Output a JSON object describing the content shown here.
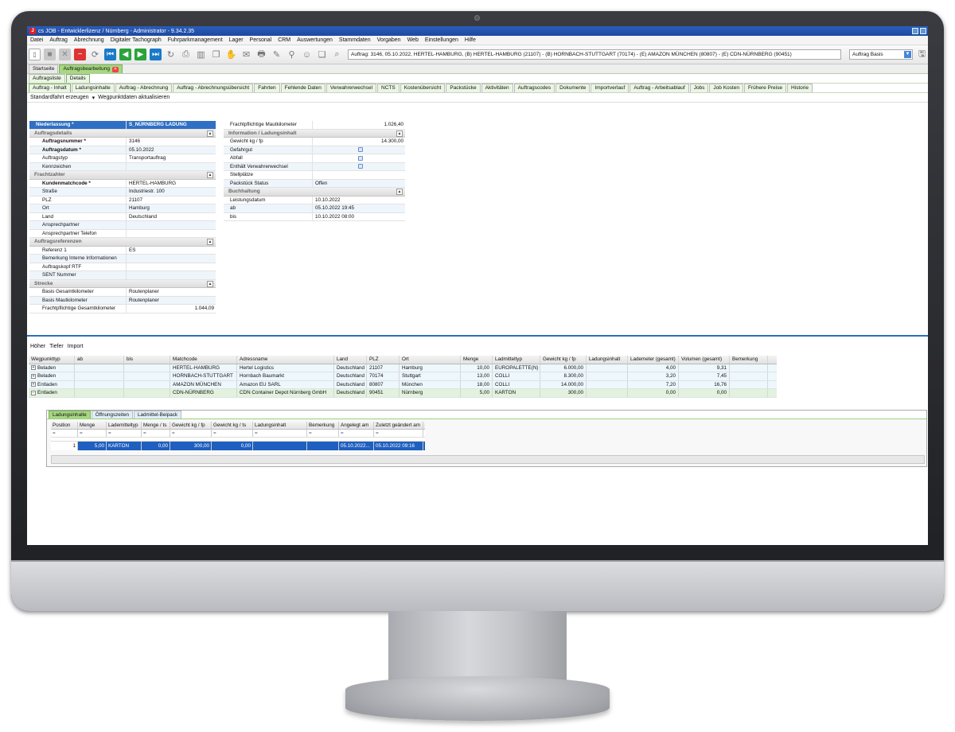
{
  "app": {
    "title": "cs JOB - Entwicklerlizenz / Nürnberg - Administrator - 9.34.2.35"
  },
  "menu": [
    "Datei",
    "Auftrag",
    "Abrechnung",
    "Digitaler Tachograph",
    "Fuhrparkmanagement",
    "Lager",
    "Personal",
    "CRM",
    "Auswertungen",
    "Stammdaten",
    "Vorgaben",
    "Web",
    "Einstellungen",
    "Hilfe"
  ],
  "toolbar": {
    "order_summary": "Auftrag: 3146, 05.10.2022, HERTEL-HAMBURG, (B) HERTEL-HAMBURG (21107) - (B) HORNBACH-STUTTGART (70174) - (E) AMAZON MÜNCHEN (80807) - (E) CDN-NÜRNBERG (90451)",
    "view_select": "Auftrag Basis"
  },
  "main_tabs": [
    {
      "label": "Startseite",
      "active": false
    },
    {
      "label": "Auftragsbearbeitung",
      "active": true
    }
  ],
  "view_tabs": [
    {
      "label": "Auftragsliste",
      "active": false
    },
    {
      "label": "Details",
      "active": true
    }
  ],
  "detail_tabs": [
    "Auftrag - Inhalt",
    "Ladungsinhalte",
    "Auftrag - Abrechnung",
    "Auftrag - Abrechnungsübersicht",
    "Fahrten",
    "Fehlende Daten",
    "Verwahrerwechsel",
    "NCTS",
    "Kostenübersicht",
    "Packstücke",
    "Aktivitäten",
    "Auftragscodes",
    "Dokumente",
    "Importverlauf",
    "Auftrag - Arbeitsablauf",
    "Jobs",
    "Job Kosten",
    "Frühere Preise",
    "Historie"
  ],
  "actions": [
    "Standardfahrt erzeugen",
    "Wegpunktdaten aktualisieren"
  ],
  "left_panel": {
    "niederlassung": {
      "label": "Niederlassung *",
      "value": "S_NÜRNBERG LADUNG"
    },
    "sections": [
      {
        "title": "Auftragsdetails",
        "rows": [
          {
            "label": "Auftragsnummer *",
            "value": "3146",
            "bold": true
          },
          {
            "label": "Auftragsdatum *",
            "value": "05.10.2022",
            "bold": true
          },
          {
            "label": "Auftragstyp",
            "value": "Transportauftrag"
          },
          {
            "label": "Kennzeichen",
            "value": ""
          }
        ]
      },
      {
        "title": "Frachtzahler",
        "rows": [
          {
            "label": "Kundenmatchcode *",
            "value": "HERTEL-HAMBURG",
            "bold": true
          },
          {
            "label": "Straße",
            "value": "Industriestr. 100"
          },
          {
            "label": "PLZ",
            "value": "21107"
          },
          {
            "label": "Ort",
            "value": "Hamburg"
          },
          {
            "label": "Land",
            "value": "Deutschland"
          },
          {
            "label": "Ansprechpartner",
            "value": ""
          },
          {
            "label": "Ansprechpartner Telefon",
            "value": ""
          }
        ]
      },
      {
        "title": "Auftragsreferenzen",
        "rows": [
          {
            "label": "Referenz 1",
            "value": "ES"
          },
          {
            "label": "Bemerkung Interne Informationen",
            "value": ""
          },
          {
            "label": "Auftragskopf RTF",
            "value": ""
          },
          {
            "label": "SENT Nummer",
            "value": ""
          }
        ]
      },
      {
        "title": "Strecke",
        "rows": [
          {
            "label": "Basis Gesamtkilometer",
            "value": "Routenplaner"
          },
          {
            "label": "Basis Mautkilometer",
            "value": "Routenplaner"
          },
          {
            "label": "Frachtpflichtige Gesamtkilometer",
            "value": "1.044,09",
            "num": true
          }
        ]
      }
    ]
  },
  "mid_panel": {
    "top_row": {
      "label": "Frachtpflichtige Mautkilometer",
      "value": "1.026,40"
    },
    "info_title": "Information / Ladungsinhalt",
    "info_rows": [
      {
        "label": "Gewicht kg / fp",
        "value": "14.300,00",
        "num": true
      },
      {
        "label": "Gefahrgut",
        "value": "",
        "check": true
      },
      {
        "label": "Abfall",
        "value": "",
        "check": true
      },
      {
        "label": "Enthält Verwahrerwechsel",
        "value": "",
        "check": true
      },
      {
        "label": "Stellplätze",
        "value": ""
      },
      {
        "label": "Packstück Status",
        "value": "Offen"
      }
    ],
    "buch_title": "Buchhaltung",
    "buch_rows": [
      {
        "label": "Leistungsdatum",
        "value": "10.10.2022"
      },
      {
        "label": "ab",
        "value": "05.10.2022 19:45"
      },
      {
        "label": "bis",
        "value": "10.10.2022 08:00"
      }
    ]
  },
  "lower_actions": [
    "Höher",
    "Tiefer",
    "Import"
  ],
  "waypoint_grid": {
    "columns": [
      "Wegpunkttyp",
      "ab",
      "bis",
      "Matchcode",
      "Adressname",
      "Land",
      "PLZ",
      "Ort",
      "Menge",
      "Ladmitteltyp",
      "Gewicht kg / fp",
      "Ladungsinhalt",
      "Lademeter (gesamt)",
      "Volumen (gesamt)",
      "Bemerkung"
    ],
    "rows": [
      [
        "Beladen",
        "",
        "",
        "HERTEL-HAMBURG",
        "Hertel Logistics",
        "Deutschland",
        "21107",
        "Hamburg",
        "10,00",
        "EUROPALETTE(N)",
        "6.000,00",
        "",
        "4,00",
        "9,31",
        ""
      ],
      [
        "Beladen",
        "",
        "",
        "HORNBACH-STUTTGART",
        "Hornbach Baumarkt",
        "Deutschland",
        "70174",
        "Stuttgart",
        "13,00",
        "COLLI",
        "8.300,00",
        "",
        "3,20",
        "7,45",
        ""
      ],
      [
        "Entladen",
        "",
        "",
        "AMAZON MÜNCHEN",
        "Amazon EU SARL",
        "Deutschland",
        "80807",
        "München",
        "18,00",
        "COLLI",
        "14.000,00",
        "",
        "7,20",
        "16,76",
        ""
      ],
      [
        "Entladen",
        "",
        "",
        "CDN-NÜRNBERG",
        "CDN Container Depot Nürnberg GmbH",
        "Deutschland",
        "90451",
        "Nürnberg",
        "5,00",
        "KARTON",
        "300,00",
        "",
        "0,00",
        "0,00",
        ""
      ]
    ]
  },
  "sub_tabs": [
    {
      "label": "Ladungsinhalte",
      "active": true
    },
    {
      "label": "Öffnungszeiten",
      "active": false
    },
    {
      "label": "Ladmittel-Beipack",
      "active": false
    }
  ],
  "cargo_grid": {
    "columns": [
      "Position",
      "Menge",
      "Lademitteltyp",
      "Menge / ts",
      "Gewicht kg / fp",
      "Gewicht kg / ts",
      "Ladungsinhalt",
      "Bemerkung",
      "Angelegt am",
      "Zuletzt geändert am"
    ],
    "filter_symbol": "=",
    "row": [
      "1",
      "5,00",
      "KARTON",
      "0,00",
      "300,00",
      "0,00",
      "",
      "",
      "05.10.2022...",
      "05.10.2022 09:16"
    ]
  },
  "colors": {
    "accent": "#2f6fc4",
    "tab_active": "#a6d87f",
    "selected_row": "#1f5fbf"
  }
}
